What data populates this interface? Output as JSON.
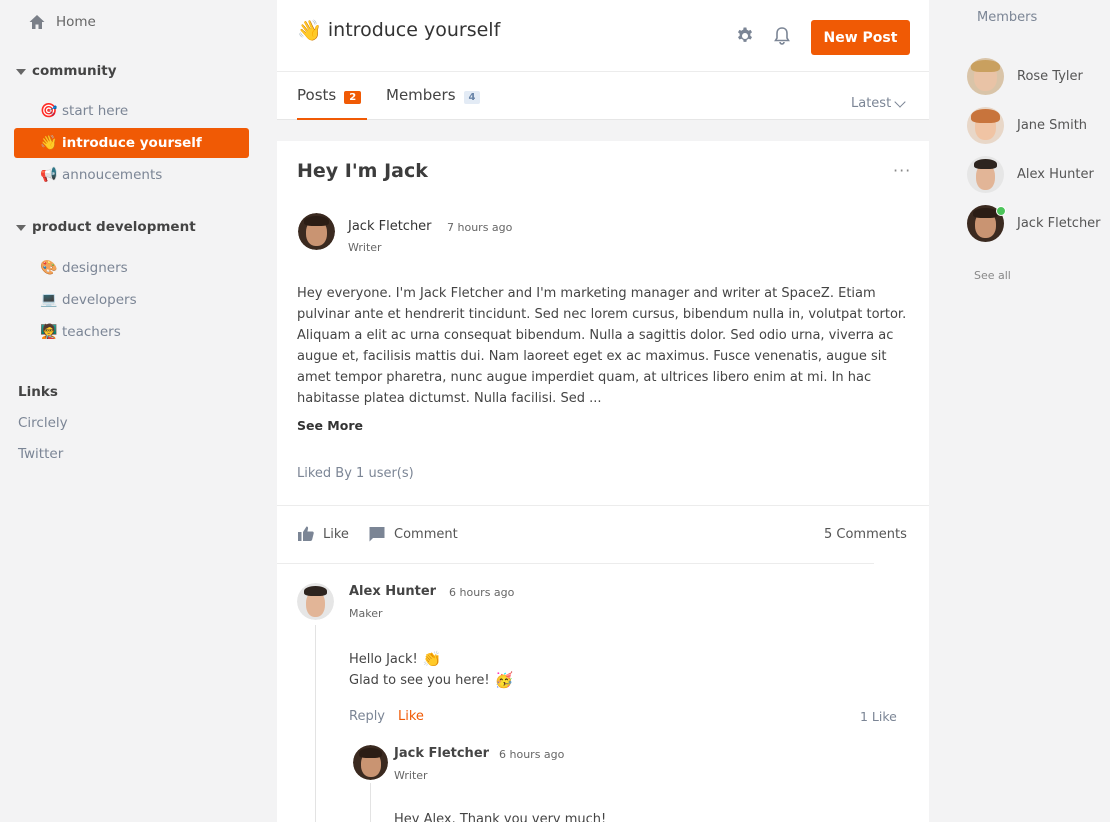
{
  "sidebar": {
    "home_label": "Home",
    "groups": [
      {
        "title": "community",
        "channels": [
          {
            "emoji": "🎯",
            "label": "start here",
            "active": false
          },
          {
            "emoji": "👋",
            "label": "introduce yourself",
            "active": true
          },
          {
            "emoji": "📢",
            "label": "annoucements",
            "active": false
          }
        ]
      },
      {
        "title": "product development",
        "channels": [
          {
            "emoji": "🎨",
            "label": "designers",
            "active": false
          },
          {
            "emoji": "💻",
            "label": "developers",
            "active": false
          },
          {
            "emoji": "🧑‍🏫",
            "label": "teachers",
            "active": false
          }
        ]
      }
    ],
    "links_title": "Links",
    "links": [
      "Circlely",
      "Twitter"
    ]
  },
  "header": {
    "emoji": "👋",
    "title": "introduce yourself",
    "new_post_label": "New Post",
    "tabs": [
      {
        "label": "Posts",
        "count": "2"
      },
      {
        "label": "Members",
        "count": "4"
      }
    ],
    "sort_label": "Latest"
  },
  "post": {
    "title": "Hey I'm Jack",
    "more_label": "···",
    "author": {
      "name": "Jack Fletcher",
      "time": "7 hours ago",
      "role": "Writer"
    },
    "body": "Hey everyone. I'm Jack Fletcher and I'm marketing manager and writer at SpaceZ. Etiam pulvinar ante et hendrerit tincidunt. Sed nec lorem cursus, bibendum nulla in, volutpat tortor. Aliquam a elit ac urna consequat bibendum. Nulla a sagittis dolor. Sed odio urna, viverra ac augue et, facilisis mattis dui. Nam laoreet eget ex ac maximus. Fusce venenatis, augue sit amet tempor pharetra, nunc augue imperdiet quam, at ultrices libero enim at mi. In hac habitasse platea dictumst. Nulla facilisi. Sed ...",
    "see_more": "See More",
    "liked_by": "Liked By 1 user(s)",
    "like_label": "Like",
    "comment_label": "Comment",
    "comments_count": "5  Comments"
  },
  "comments": [
    {
      "name": "Alex Hunter",
      "time": "6 hours ago",
      "role": "Maker",
      "line1": "Hello Jack!",
      "line1_emoji": "👏",
      "line2": "Glad to see you here!",
      "line2_emoji": "🥳",
      "reply_label": "Reply",
      "like_label": "Like",
      "likes": "1 Like"
    },
    {
      "name": "Jack Fletcher",
      "time": "6 hours ago",
      "role": "Writer",
      "line1": "Hey Alex. Thank you very much!"
    }
  ],
  "members": {
    "title": "Members",
    "list": [
      {
        "name": "Rose Tyler",
        "online": false
      },
      {
        "name": "Jane Smith",
        "online": false
      },
      {
        "name": "Alex Hunter",
        "online": false
      },
      {
        "name": "Jack Fletcher",
        "online": true
      }
    ],
    "see_all": "See all"
  },
  "colors": {
    "accent": "#f05a05",
    "muted": "#7b8595",
    "online": "#4cc45a"
  }
}
